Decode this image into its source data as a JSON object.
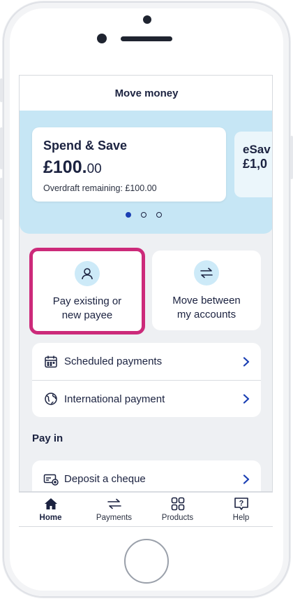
{
  "header": {
    "title": "Move money"
  },
  "accounts": [
    {
      "name": "Spend & Save",
      "balance_major": "£100.",
      "balance_minor": "00",
      "overdraft": "Overdraft remaining: £100.00"
    },
    {
      "name": "eSav",
      "balance": "£1,0"
    }
  ],
  "carousel": {
    "page_count": 3,
    "active_index": 0
  },
  "actions": {
    "pay": {
      "label_line1": "Pay existing or",
      "label_line2": "new payee",
      "icon": "person-icon"
    },
    "move": {
      "label_line1": "Move between",
      "label_line2": "my accounts",
      "icon": "transfer-arrows-icon"
    }
  },
  "payments_list": [
    {
      "label": "Scheduled payments",
      "icon": "calendar-icon"
    },
    {
      "label": "International payment",
      "icon": "globe-icon"
    }
  ],
  "pay_in": {
    "heading": "Pay in",
    "items": [
      {
        "label": "Deposit a cheque",
        "icon": "cheque-icon"
      }
    ]
  },
  "tabs": [
    {
      "label": "Home",
      "icon": "home-icon",
      "active": true
    },
    {
      "label": "Payments",
      "icon": "transfer-arrows-icon",
      "active": false
    },
    {
      "label": "Products",
      "icon": "grid-icon",
      "active": false
    },
    {
      "label": "Help",
      "icon": "help-icon",
      "active": false
    }
  ],
  "colors": {
    "highlight": "#cc2a7a",
    "navy": "#1b2240",
    "accent_blue": "#1a3fb3",
    "carousel_bg": "#c6e6f5"
  }
}
